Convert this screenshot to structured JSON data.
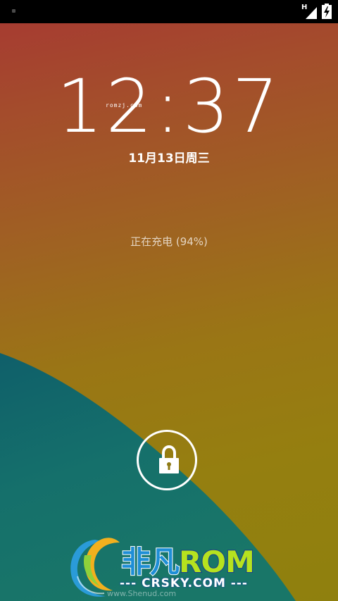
{
  "status_bar": {
    "network_type": "H",
    "icons": [
      "notification-dot-icon",
      "signal-icon",
      "battery-charging-icon"
    ]
  },
  "lockscreen": {
    "time": "12:37",
    "date": "11月13日周三",
    "charging_status": "正在充电 (94%)",
    "battery_level_percent": 94,
    "unlock_icon": "lock-icon"
  },
  "watermarks": {
    "small": "romzj.com",
    "logo_brand": "非凡",
    "logo_rom": "ROM",
    "logo_domain": "--- CRSKY.COM ---",
    "logo_site": "www.Shenud.com"
  },
  "colors": {
    "wallpaper_top": "#a63c31",
    "wallpaper_bottom": "#8f800e",
    "wave_teal": "#14706b",
    "logo_blue": "#1e8ed6",
    "logo_green": "#b6e21f"
  }
}
